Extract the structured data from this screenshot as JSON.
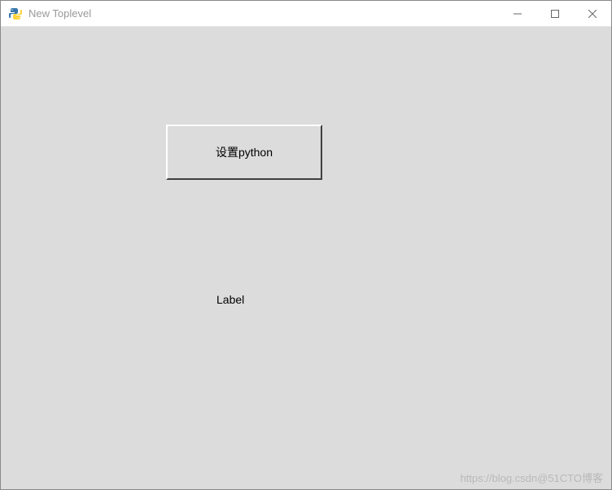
{
  "window": {
    "title": "New Toplevel"
  },
  "client": {
    "button_label": "设置python",
    "label_text": "Label"
  },
  "watermark": "https://blog.csdn@51CTO博客"
}
